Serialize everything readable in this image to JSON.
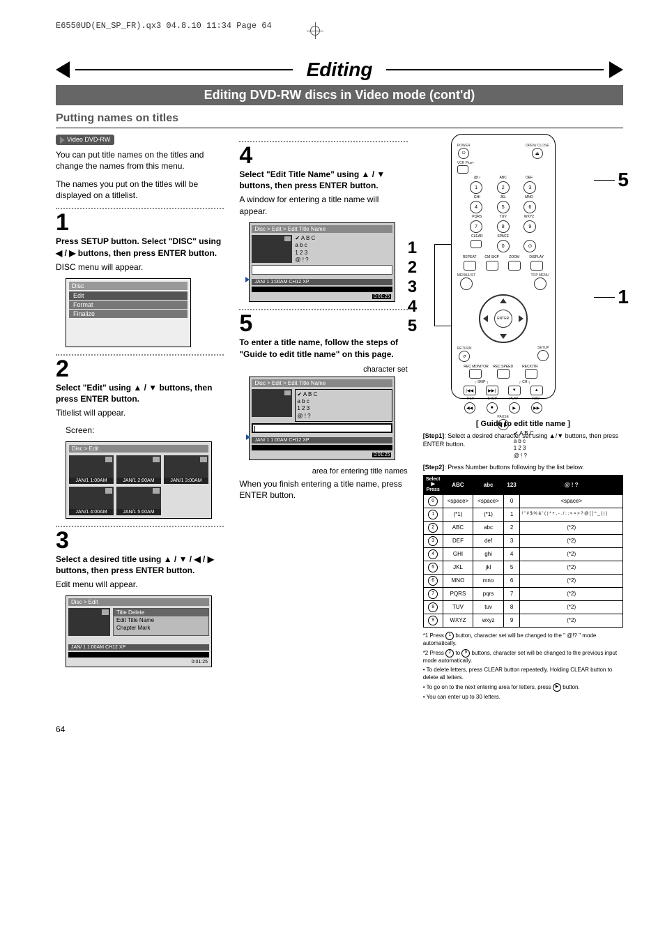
{
  "header_runner": "E6550UD(EN_SP_FR).qx3  04.8.10  11:34  Page 64",
  "page_number": "64",
  "title": "Editing",
  "subtitle": "Editing DVD-RW discs in Video mode (cont'd)",
  "section_heading": "Putting names on titles",
  "badge": "Video DVD-RW",
  "intro1": "You can put title names on the titles and change the names from this menu.",
  "intro2": "The names you put on the titles will be displayed on a titlelist.",
  "step1": {
    "num": "1",
    "desc": "Press SETUP button. Select \"DISC\" using ◀ / ▶ buttons, then press ENTER button.",
    "sub": "DISC menu will appear."
  },
  "discmenu": {
    "title": "Disc",
    "items": [
      "Edit",
      "Format",
      "Finalize"
    ]
  },
  "step2": {
    "num": "2",
    "desc": "Select \"Edit\" using ▲ / ▼ buttons, then press ENTER button.",
    "sub": "Titlelist will appear.",
    "screen_label": "Screen:"
  },
  "titlelist": {
    "path": "Disc > Edit",
    "thumbs": [
      "JAN/1  1:00AM",
      "JAN/1  2:00AM",
      "JAN/1  3:00AM",
      "JAN/1  4:00AM",
      "JAN/1  5:00AM"
    ]
  },
  "step3": {
    "num": "3",
    "desc": "Select a desired title using ▲ / ▼ / ◀ / ▶ buttons, then press ENTER button.",
    "sub": "Edit menu will appear."
  },
  "editmenu": {
    "path": "Disc > Edit",
    "items": [
      "Title Delete",
      "Edit Title Name",
      "Chapter Mark"
    ],
    "bar": "JAN/ 1  1:00AM  CH12   XP",
    "dur": "0:01:25"
  },
  "step4": {
    "num": "4",
    "desc": "Select \"Edit Title Name\" using ▲ / ▼ buttons, then press ENTER button.",
    "sub": "A window for entering a title name will appear."
  },
  "tnbox1": {
    "path": "Disc > Edit > Edit Title Name",
    "opts": [
      "A B C",
      "a b c",
      "1 2 3",
      "@ ! ?"
    ],
    "bar": "JAN/ 1  1:00AM  CH12   XP",
    "dur": "0:01:25"
  },
  "step5": {
    "num": "5",
    "desc": "To enter a title name, follow the steps of \"Guide to edit title name\" on this page.",
    "cap1": "character set",
    "cap2": "area for entering title names",
    "tail": "When you finish entering a title name, press ENTER button."
  },
  "tnbox2": {
    "path": "Disc > Edit > Edit Title Name",
    "opts": [
      "A B C",
      "a b c",
      "1 2 3",
      "@ ! ?"
    ],
    "bar": "JAN/ 1  1:00AM  CH12   XP",
    "dur": "0:01:25"
  },
  "remote": {
    "power": "POWER",
    "open": "OPEN/ CLOSE",
    "vcrplus": "VCR Plus+",
    "keypad_labels": [
      "@!./",
      "ABC",
      "DEF",
      "GHI",
      "JKL",
      "MNO",
      "PQRS",
      "TUV",
      "WXYZ"
    ],
    "keypad_nums": [
      "1",
      "2",
      "3",
      "4",
      "5",
      "6",
      "7",
      "8",
      "9",
      "0"
    ],
    "clear": "CLEAR",
    "space": "SPACE",
    "row_btns": [
      "REPEAT",
      "CM SKIP",
      "ZOOM",
      "DISPLAY"
    ],
    "menulist": "MENU/LIST",
    "topmenu": "TOP MENU",
    "enter": "ENTER",
    "return": "RETURN",
    "setup": "SETUP",
    "rec_row": [
      "REC MONITOR",
      "REC SPEED",
      "REC/OTR"
    ],
    "skip": "SKIP",
    "ch": "CH",
    "transport": [
      "REV",
      "STOP",
      "PLAY",
      "FWD"
    ],
    "pause": "PAUSE",
    "transport_icons": [
      "|◀◀",
      "▶▶|",
      "▼",
      "▲",
      "◀◀",
      "■",
      "▶",
      "▶▶",
      "❚❚"
    ]
  },
  "callouts_right": {
    "five": "5",
    "one": "1"
  },
  "callouts_left": [
    "1",
    "2",
    "3",
    "4",
    "5"
  ],
  "guide": {
    "title": "[ Guide to edit title name ]",
    "step1": "[Step1]: Select a desired character set using ▲/▼ buttons, then press ENTER button.",
    "opts": [
      "A B C",
      "a b c",
      "1 2 3",
      "@ ! ?"
    ],
    "step2": "[Step2]: Press Number buttons following by the list below.",
    "tbl_head_sel": "Select",
    "tbl_head_press": "Press",
    "cols": [
      "ABC",
      "abc",
      "123",
      "@ ! ?"
    ],
    "rows": [
      {
        "k": "0",
        "c": [
          "<space>",
          "<space>",
          "0",
          "<space>"
        ]
      },
      {
        "k": "1",
        "c": [
          "(*1)",
          "(*1)",
          "1",
          "! \" # $ % & ' ( ) * + , - . / : ; < = > ? @ [ ] ^ _ { | }"
        ]
      },
      {
        "k": "2",
        "c": [
          "ABC",
          "abc",
          "2",
          "(*2)"
        ]
      },
      {
        "k": "3",
        "c": [
          "DEF",
          "def",
          "3",
          "(*2)"
        ]
      },
      {
        "k": "4",
        "c": [
          "GHI",
          "ghi",
          "4",
          "(*2)"
        ]
      },
      {
        "k": "5",
        "c": [
          "JKL",
          "jkl",
          "5",
          "(*2)"
        ]
      },
      {
        "k": "6",
        "c": [
          "MNO",
          "mno",
          "6",
          "(*2)"
        ]
      },
      {
        "k": "7",
        "c": [
          "PQRS",
          "pqrs",
          "7",
          "(*2)"
        ]
      },
      {
        "k": "8",
        "c": [
          "TUV",
          "tuv",
          "8",
          "(*2)"
        ]
      },
      {
        "k": "9",
        "c": [
          "WXYZ",
          "wxyz",
          "9",
          "(*2)"
        ]
      }
    ],
    "note1": "*1 Press ① button, character set will be changed to the \" @!? \" mode automatically.",
    "note2": "*2 Press ② to ⑨ buttons, character set will be changed to the previous input mode automatically.",
    "bul1": "• To delete letters, press CLEAR button repeatedly. Holding CLEAR button to delete all letters.",
    "bul2": "• To go on to the next entering area for letters, press  ▶  button.",
    "bul3": "• You can enter up to 30 letters."
  }
}
